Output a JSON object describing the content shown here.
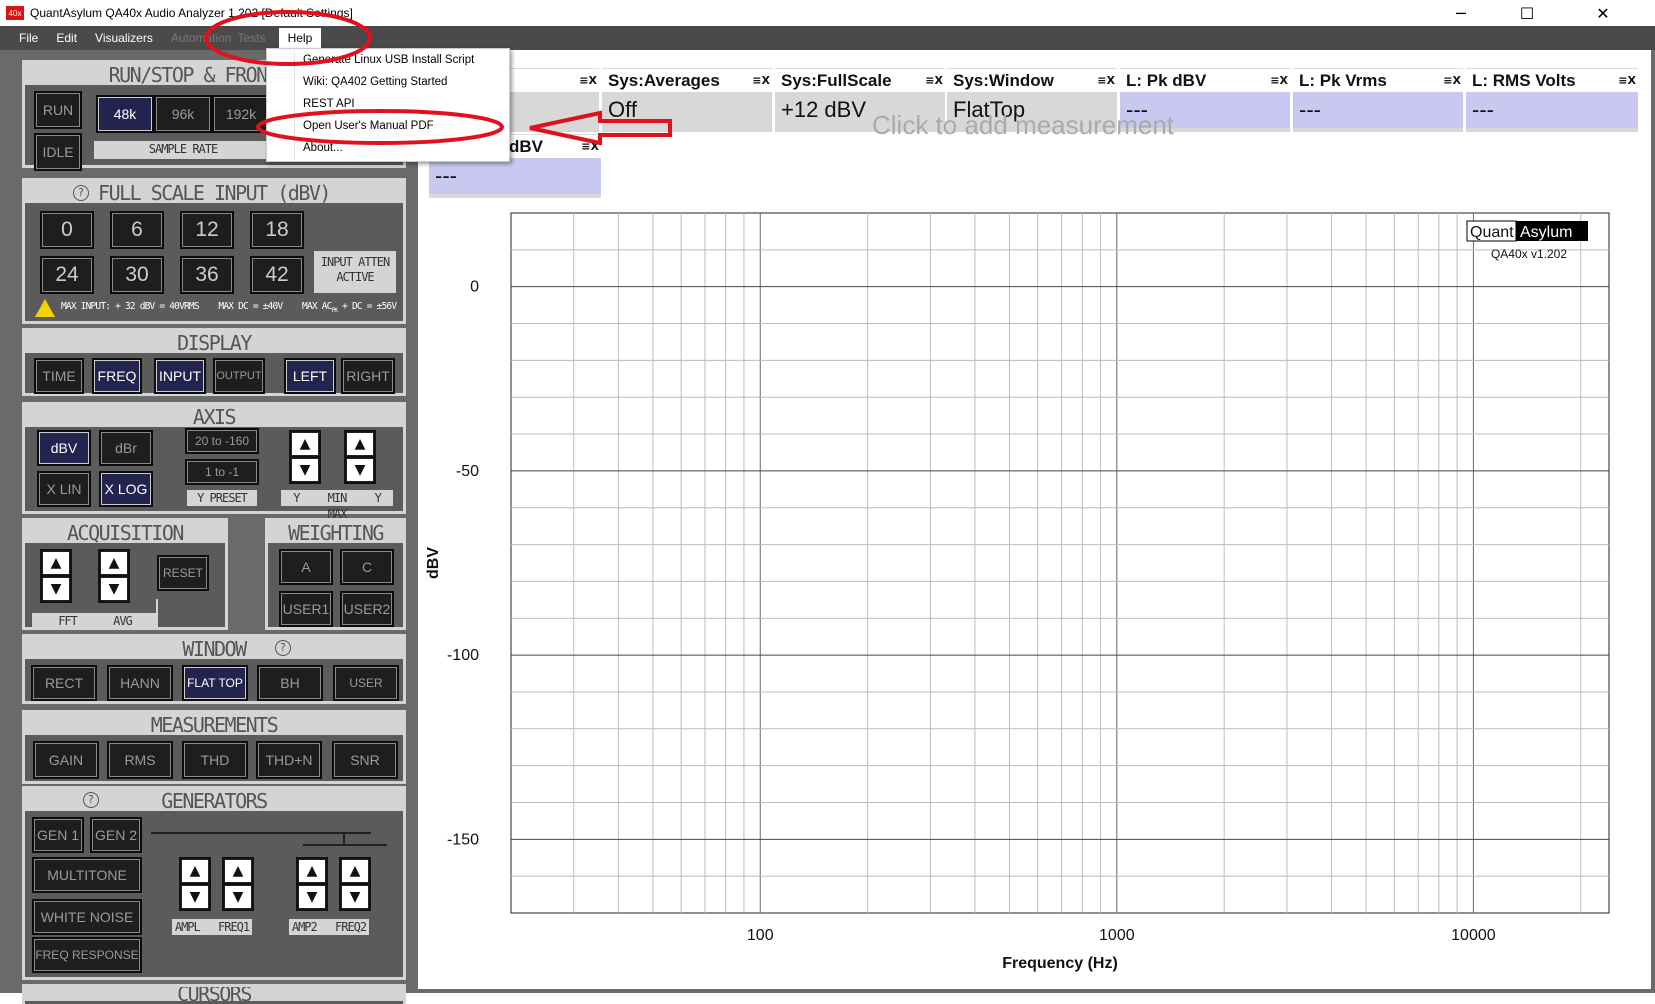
{
  "window": {
    "title": "QuantAsylum QA40x Audio Analyzer 1.202 [Default Settings]",
    "icon_text": "40x",
    "minimize": "─",
    "maximize": "☐",
    "close": "✕"
  },
  "menu": {
    "file": "File",
    "edit": "Edit",
    "visualizers": "Visualizers",
    "automation": "Automation",
    "tests": "Tests",
    "help": "Help"
  },
  "help_menu": {
    "items": [
      "Generate Linux USB Install Script",
      "Wiki: QA402 Getting Started",
      "REST API",
      "Open User's Manual PDF",
      "About..."
    ]
  },
  "run_panel": {
    "title": "RUN/STOP & FRONT END",
    "run": "RUN",
    "idle": "IDLE",
    "rates": [
      "48k",
      "96k",
      "192k"
    ],
    "sample_rate_label": "SAMPLE RATE"
  },
  "fullscale": {
    "title": "FULL SCALE INPUT (dBV)",
    "help": "?",
    "values": [
      "0",
      "6",
      "12",
      "18",
      "24",
      "30",
      "36",
      "42"
    ],
    "atten": "INPUT ATTEN ACTIVE",
    "warning": "MAX INPUT: + 32 dBV = 40VRMS    MAX DC = ±40V    MAX AC",
    "warning_sub": "PK",
    "warning_end": " + DC = ±56V"
  },
  "display": {
    "title": "DISPLAY",
    "buttons": [
      "TIME",
      "FREQ",
      "INPUT",
      "OUTPUT",
      "LEFT",
      "RIGHT"
    ]
  },
  "axis": {
    "title": "AXIS",
    "dbv": "dBV",
    "dbr": "dBr",
    "xlin": "X LIN",
    "xlog": "X LOG",
    "preset1": "20 to -160",
    "preset2": "1 to -1",
    "ypreset": "Y PRESET",
    "ymin": "Y MIN",
    "ymax": "Y MAX"
  },
  "acquisition": {
    "title": "ACQUISITION",
    "reset": "RESET",
    "fft": "FFT",
    "avg": "AVG"
  },
  "weighting": {
    "title": "WEIGHTING",
    "a": "A",
    "c": "C",
    "user1": "USER1",
    "user2": "USER2"
  },
  "window_panel": {
    "title": "WINDOW",
    "help": "?",
    "buttons": [
      "RECT",
      "HANN",
      "FLAT TOP",
      "BH",
      "USER"
    ]
  },
  "measurements": {
    "title": "MEASUREMENTS",
    "buttons": [
      "GAIN",
      "RMS",
      "THD",
      "THD+N",
      "SNR"
    ]
  },
  "generators": {
    "title": "GENERATORS",
    "help": "?",
    "gen1": "GEN 1",
    "gen2": "GEN 2",
    "multitone": "MULTITONE",
    "white_noise": "WHITE NOISE",
    "freq_response": "FREQ RESPONSE",
    "ampl1": "AMPL",
    "freq1": "FREQ1",
    "amp2": "AMP2",
    "freq2": "FREQ2"
  },
  "cursors": {
    "title": "CURSORS"
  },
  "tiles": [
    {
      "head": "",
      "value": ""
    },
    {
      "head": "Sys:Averages",
      "value": "Off"
    },
    {
      "head": "Sys:FullScale",
      "value": "+12 dBV"
    },
    {
      "head": "Sys:Window",
      "value": "FlatTop"
    },
    {
      "head": "L: Pk dBV",
      "value": "---"
    },
    {
      "head": "L: Pk Vrms",
      "value": "---"
    },
    {
      "head": "L: RMS Volts",
      "value": "---"
    }
  ],
  "tile2": {
    "head": "dBV",
    "value": "---"
  },
  "tile_ctl": "≡X",
  "add_measurement": "Click to add measurement",
  "brand": {
    "quant": "Quant",
    "asylum": "Asylum",
    "version": "QA40x v1.202"
  },
  "chart_data": {
    "type": "line",
    "xlabel": "Frequency (Hz)",
    "ylabel": "dBV",
    "xscale": "log",
    "xlim": [
      20,
      24000
    ],
    "ylim": [
      -170,
      20
    ],
    "x_ticks": [
      "100",
      "1000",
      "10000"
    ],
    "y_ticks": [
      "0",
      "-50",
      "-100",
      "-150"
    ],
    "grid": true,
    "series": []
  },
  "colors": {
    "annotation": "#e0101e",
    "accent_button": "#232350",
    "tile_blue": "#c8c8f0"
  }
}
